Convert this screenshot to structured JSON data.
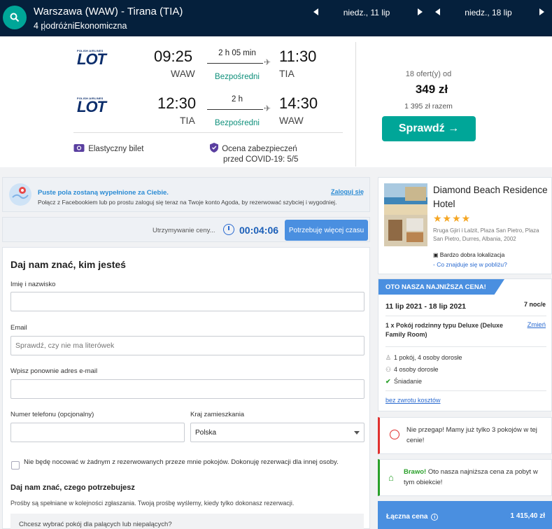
{
  "search": {
    "route": "Warszawa (WAW) - Tirana (TIA)",
    "travellers": "4 podróżni",
    "cabin": "Ekonomiczna",
    "depart_date": "niedz., 11 lip",
    "return_date": "niedz., 18 lip"
  },
  "flights": {
    "outbound": {
      "airline": "LOT",
      "airline_small": "POLISH AIRLINES",
      "dep_time": "09:25",
      "dep_code": "WAW",
      "arr_time": "11:30",
      "arr_code": "TIA",
      "duration": "2 h 05 min",
      "stops": "Bezpośredni"
    },
    "inbound": {
      "airline": "LOT",
      "airline_small": "POLISH AIRLINES",
      "dep_time": "12:30",
      "dep_code": "TIA",
      "arr_time": "14:30",
      "arr_code": "WAW",
      "duration": "2 h",
      "stops": "Bezpośredni"
    },
    "flex_ticket": "Elastyczny bilet",
    "covid_line1": "Ocena zabezpieczeń",
    "covid_line2": "przed COVID-19: 5/5",
    "offers": "18 ofert(y) od",
    "price": "349 zł",
    "total": "1 395 zł razem",
    "check_button": "Sprawdź →"
  },
  "facebook": {
    "bold": "Puste pola zostaną wypełnione za Ciebie.",
    "text": "Połącz z Facebookiem lub po prostu zaloguj się teraz na Twoje konto Agoda, by rezerwować szybciej i wygodniej.",
    "login": "Zaloguj się"
  },
  "timer": {
    "label": "Utrzymywanie ceny...",
    "value": "00:04:06",
    "button": "Potrzebuję więcej czasu"
  },
  "form": {
    "title": "Daj nam znać, kim jesteś",
    "name_label": "Imię i nazwisko",
    "email_label": "Email",
    "email_placeholder": "Sprawdź, czy nie ma literówek",
    "email_repeat_label": "Wpisz ponownie adres e-mail",
    "phone_label": "Numer telefonu (opcjonalny)",
    "country_label": "Kraj zamieszkania",
    "country_value": "Polska",
    "checkbox_text": "Nie będę nocować w żadnym z rezerwowanych przeze mnie pokojów. Dokonuję rezerwacji dla innej osoby.",
    "needs_title": "Daj nam znać, czego potrzebujesz",
    "needs_text": "Prośby są spełniane w kolejności zgłaszania. Twoją prośbę wyślemy, kiedy tylko dokonasz rezerwacji.",
    "smoking_question": "Chcesz wybrać pokój dla palących lub niepalących?"
  },
  "hotel": {
    "name": "Diamond Beach Residence Hotel",
    "stars": "★★★★",
    "address": "Rruga Gjiri i Lalzit, Plaza San Pietro, Plaza San Pietro, Durres, Albania, 2002",
    "location": "Bardzo dobra lokalizacja",
    "nearby": "- Co znajduje się w pobliżu?"
  },
  "offer": {
    "banner": "OTO NASZA NAJNIŻSZA CENA!",
    "dates": "11 lip 2021 - 18 lip 2021",
    "nights": "7 noc/e",
    "room": "1 x Pokój rodzinny typu Deluxe (Deluxe Family Room)",
    "change": "Zmień",
    "rooms_people": "1 pokój, 4 osoby dorosłe",
    "adults": "4 osoby dorosłe",
    "breakfast": "Śniadanie",
    "refund": "bez zwrotu kosztów"
  },
  "notices": {
    "urgent": "Nie przegap! Mamy już tylko 3 pokojów w tej cenie!",
    "best_bold": "Brawo!",
    "best_text": " Oto nasza najniższa cena za pobyt w tym obiekcie!"
  },
  "total": {
    "label": "Łączna cena",
    "value": "1 415,40 zł"
  }
}
